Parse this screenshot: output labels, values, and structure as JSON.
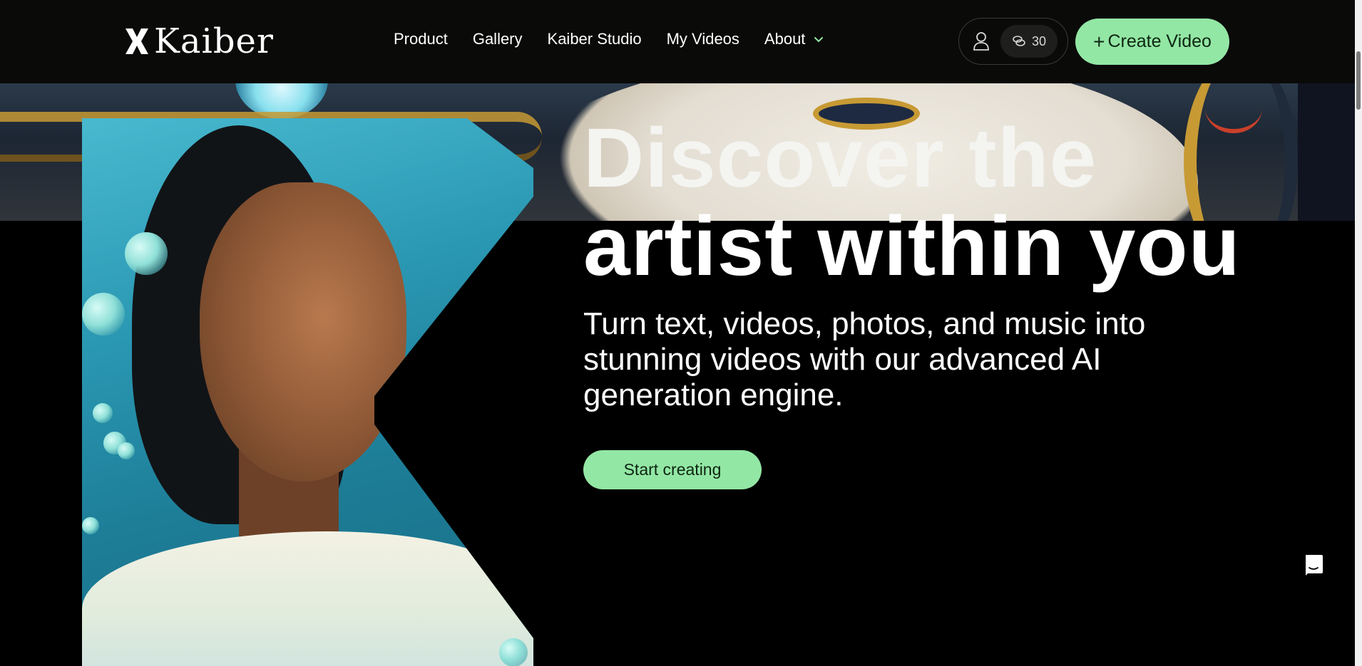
{
  "brand": {
    "name": "Kaiber"
  },
  "nav": {
    "items": [
      {
        "label": "Product"
      },
      {
        "label": "Gallery"
      },
      {
        "label": "Kaiber Studio"
      },
      {
        "label": "My Videos"
      },
      {
        "label": "About"
      }
    ]
  },
  "account": {
    "credits": "30",
    "create_label": "Create Video",
    "create_icon": "+"
  },
  "hero": {
    "title_line1": "Discover the",
    "title_line2": "artist within you",
    "subtitle": "Turn text, videos, photos, and music into stunning videos with our advanced AI generation engine.",
    "cta_label": "Start creating"
  },
  "colors": {
    "accent": "#93e7a4",
    "background": "#000000",
    "header": "#0a0a09"
  },
  "icons": [
    "kaiber-logo-icon",
    "chevron-down-icon",
    "user-icon",
    "coins-icon",
    "plus-icon",
    "chat-icon"
  ]
}
